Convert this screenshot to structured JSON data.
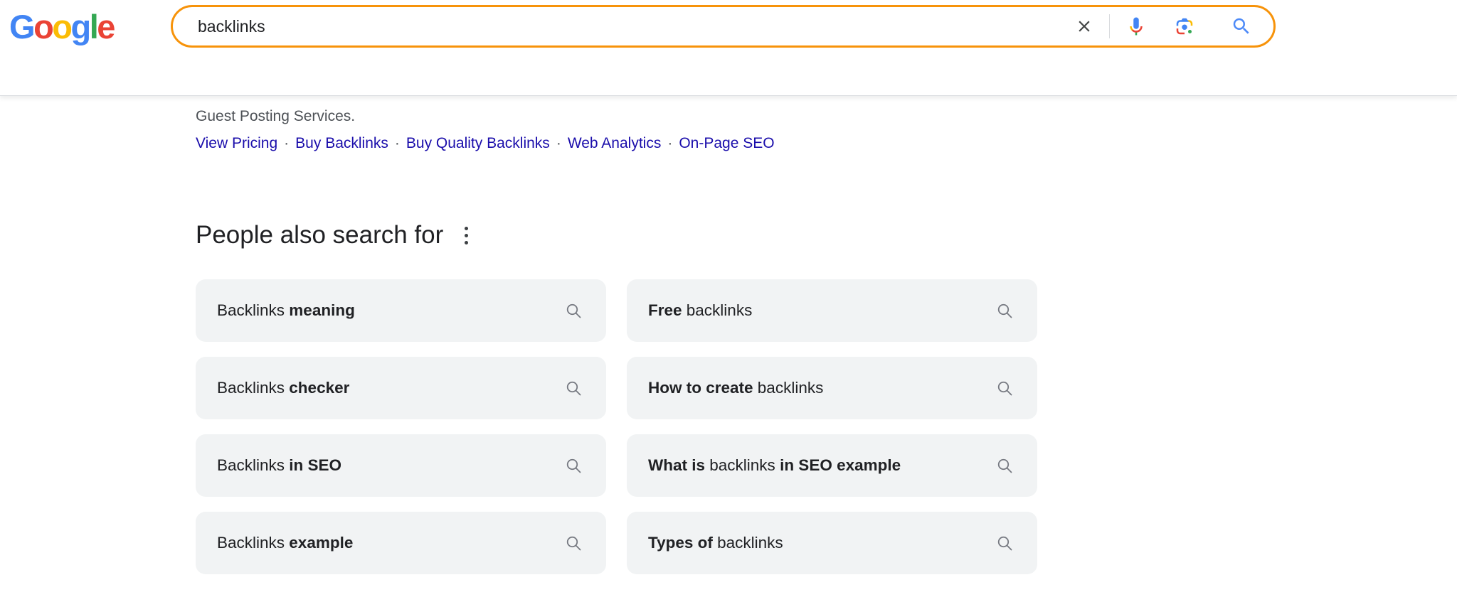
{
  "app": {
    "title": "Google Search results"
  },
  "colors": {
    "search_border_orange": "#f7930a",
    "link_blue": "#1a0dab",
    "text_dark": "#202124",
    "text_gray": "#4d5156",
    "chip_background": "#f1f3f4",
    "chip_icon_gray": "#757880",
    "google_blue": "#4285F4",
    "google_red": "#EA4335",
    "google_yellow": "#FBBC05",
    "google_green": "#34A853"
  },
  "logo": {
    "text": "Google",
    "letters": [
      {
        "ch": "G",
        "color": "#4285F4"
      },
      {
        "ch": "o",
        "color": "#EA4335"
      },
      {
        "ch": "o",
        "color": "#FBBC05"
      },
      {
        "ch": "g",
        "color": "#4285F4"
      },
      {
        "ch": "l",
        "color": "#34A853"
      },
      {
        "ch": "e",
        "color": "#EA4335"
      }
    ]
  },
  "search": {
    "query": "backlinks",
    "icons": {
      "clear": "x-clear-icon",
      "voice": "google-mic-icon",
      "lens": "google-lens-icon",
      "submit": "blue-magnifier-icon"
    }
  },
  "result": {
    "snippet": "Guest Posting Services.",
    "separator": "·",
    "sitelinks": [
      "View Pricing",
      "Buy Backlinks",
      "Buy Quality Backlinks",
      "Web Analytics",
      "On-Page SEO"
    ]
  },
  "people_also_search_for": {
    "title": "People also search for",
    "menu_icon": "three-dot-menu-icon",
    "chip_icon": "gray-magnifier-icon",
    "chips": [
      {
        "parts": [
          {
            "text": "Backlinks ",
            "bold": false
          },
          {
            "text": "meaning",
            "bold": true
          }
        ]
      },
      {
        "parts": [
          {
            "text": "Free",
            "bold": true
          },
          {
            "text": " backlinks",
            "bold": false
          }
        ]
      },
      {
        "parts": [
          {
            "text": "Backlinks ",
            "bold": false
          },
          {
            "text": "checker",
            "bold": true
          }
        ]
      },
      {
        "parts": [
          {
            "text": "How to create",
            "bold": true
          },
          {
            "text": " backlinks",
            "bold": false
          }
        ]
      },
      {
        "parts": [
          {
            "text": "Backlinks ",
            "bold": false
          },
          {
            "text": "in SEO",
            "bold": true
          }
        ]
      },
      {
        "parts": [
          {
            "text": "What is",
            "bold": true
          },
          {
            "text": " backlinks ",
            "bold": false
          },
          {
            "text": "in SEO example",
            "bold": true
          }
        ]
      },
      {
        "parts": [
          {
            "text": "Backlinks ",
            "bold": false
          },
          {
            "text": "example",
            "bold": true
          }
        ]
      },
      {
        "parts": [
          {
            "text": "Types of",
            "bold": true
          },
          {
            "text": " backlinks",
            "bold": false
          }
        ]
      }
    ]
  }
}
